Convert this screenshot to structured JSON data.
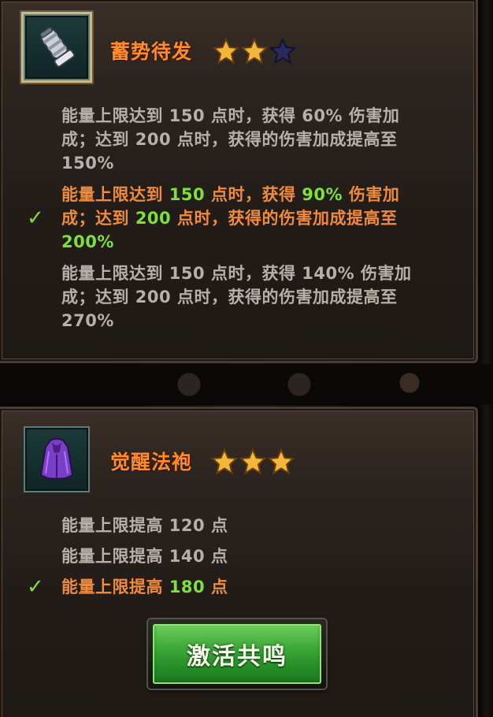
{
  "resonances": [
    {
      "name": "蓄势待发",
      "icon": "gauntlet-icon",
      "stars_filled": 2,
      "stars_total": 3,
      "tiers": [
        {
          "active": false,
          "line1": "能量上限达到 150 点时，获得 60% 伤害加",
          "line2": "成；达到 200 点时，获得的伤害加成提高至",
          "line3": "150%"
        },
        {
          "active": true,
          "l1a": "能量上限达到 ",
          "l1b": "150",
          "l1c": " 点时，获得 ",
          "l1d": "90%",
          "l1e": " 伤害加",
          "l2a": "成；达到 ",
          "l2b": "200",
          "l2c": " 点时，获得的伤害加成提高至",
          "l3": "200%"
        },
        {
          "active": false,
          "line1": "能量上限达到 150 点时，获得 140% 伤害加",
          "line2": "成；达到 200 点时，获得的伤害加成提高至",
          "line3": "270%"
        }
      ]
    },
    {
      "name": "觉醒法袍",
      "icon": "robe-icon",
      "stars_filled": 3,
      "stars_total": 3,
      "tiers": [
        {
          "active": false,
          "text": "能量上限提高 120 点"
        },
        {
          "active": false,
          "text": "能量上限提高 140 点"
        },
        {
          "active": true,
          "a": "能量上限提高 ",
          "b": "180",
          "c": " 点"
        }
      ]
    }
  ],
  "checkmark": "✓",
  "action_button": "激活共鸣",
  "colors": {
    "title": "#ff8a2d",
    "inactive_text": "#b8b0a8",
    "active_text": "#f08a3c",
    "highlight": "#7ee03a",
    "button": "#3da83a"
  }
}
